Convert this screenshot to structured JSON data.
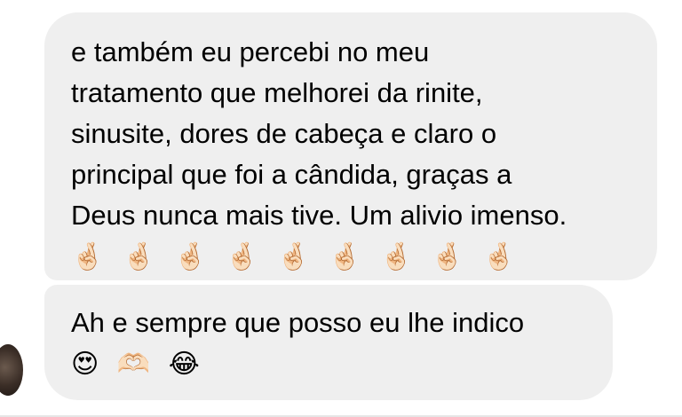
{
  "messages": [
    {
      "lines": [
        "e também eu percebi no meu",
        "tratamento que melhorei da rinite,",
        "sinusite, dores de cabeça e claro o",
        "principal que foi a cândida, graças a",
        "Deus nunca mais tive. Um alivio imenso."
      ],
      "emojis": [
        "🤞🏻",
        "🤞🏻",
        "🤞🏻",
        "🤞🏻",
        "🤞🏻",
        "🤞🏻",
        "🤞🏻",
        "🤞🏻",
        "🤞🏻"
      ]
    },
    {
      "lines": [
        "Ah e sempre que posso eu lhe indico"
      ],
      "emojis": [
        "😍",
        "🫶🏻",
        "😂"
      ]
    }
  ],
  "emoji_names": {
    "crossed_fingers": "crossed-fingers-icon",
    "heart_eyes": "heart-eyes-icon",
    "heart_hands": "heart-hands-icon",
    "tears_of_joy": "tears-of-joy-icon"
  },
  "colors": {
    "bubble_background": "#efefef",
    "text": "#000000",
    "page_background": "#ffffff"
  }
}
